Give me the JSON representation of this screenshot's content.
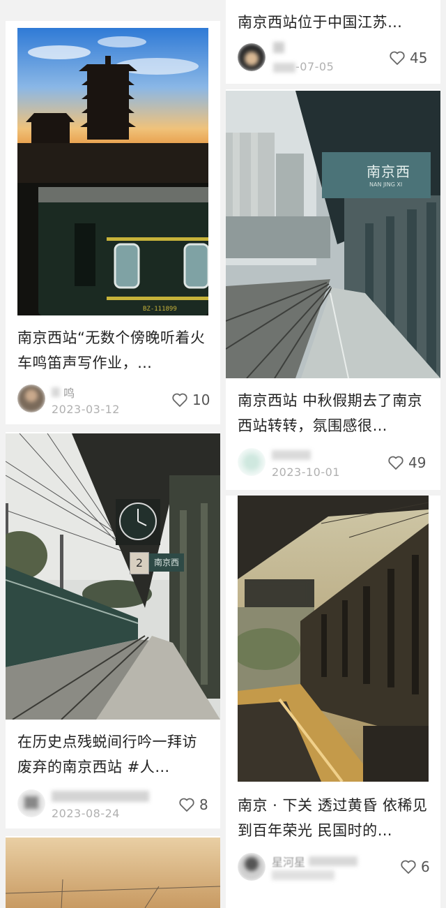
{
  "feed": {
    "cards": [
      {
        "title": "南京西站“无数个傍晚听着火车鸣笛声写作业，…",
        "user": "鸣",
        "date": "2023-03-12",
        "likes": "10"
      },
      {
        "title": "南京西站位于中国江苏…",
        "user": "",
        "date": "-07-05",
        "likes": "45"
      },
      {
        "title": "南京西站 中秋假期去了南京西站转转，氛围感很…",
        "user": "",
        "date": "2023-10-01",
        "likes": "49"
      },
      {
        "title": "在历史点残蜕间行吟一拜访废弃的南京西站 #人…",
        "user": "",
        "date": "2023-08-24",
        "likes": "8"
      },
      {
        "title": "南京 · 下关 透过黄昏 依稀见到百年荣光 民国时的…",
        "user": "星河星",
        "date": "",
        "likes": "6"
      }
    ],
    "photo_texts": {
      "station_sign": "南京西",
      "station_sign_pinyin": "NAN JING XI",
      "platform_number": "2",
      "platform_sign": "南京西",
      "train_plate": "BZ-111899"
    }
  },
  "colors": {
    "background": "#f2f2f2",
    "card": "#ffffff",
    "title_text": "#222222",
    "meta_text": "#b0b0b0"
  },
  "icons": {
    "like": "heart-outline-icon"
  }
}
